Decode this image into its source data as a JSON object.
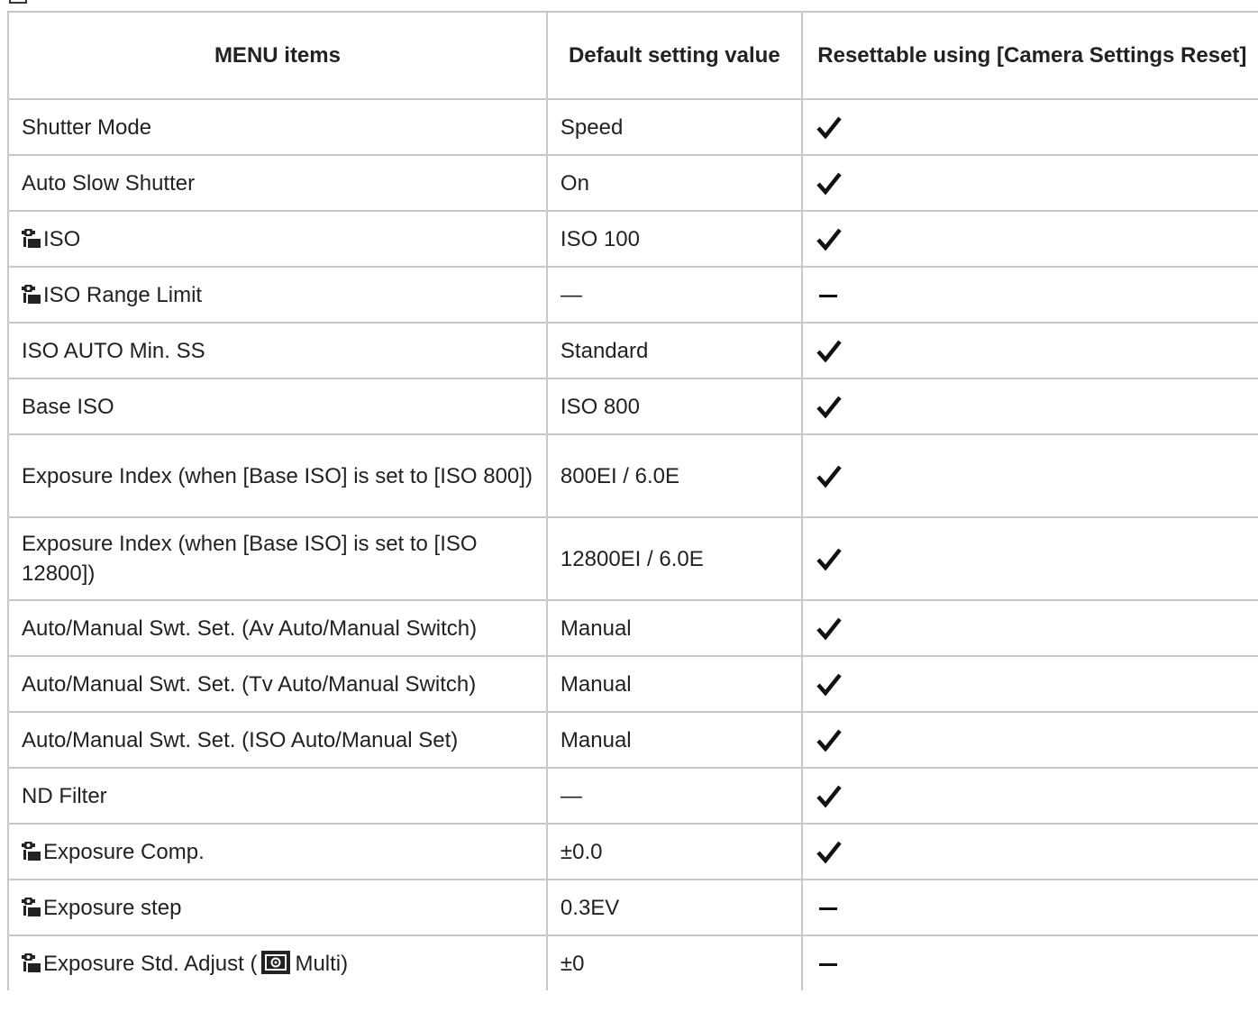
{
  "table": {
    "headers": [
      "MENU items",
      "Default setting value",
      "Resettable using [Camera Settings Reset]"
    ],
    "rows": [
      {
        "item": "Shutter Mode",
        "icon": "",
        "default": "Speed",
        "reset": "check"
      },
      {
        "item": "Auto Slow Shutter",
        "icon": "",
        "default": "On",
        "reset": "check"
      },
      {
        "item": "ISO",
        "icon": "camera-still-movie-icon",
        "default": "ISO 100",
        "reset": "check"
      },
      {
        "item": "ISO Range Limit",
        "icon": "camera-still-movie-icon",
        "default": "—",
        "reset": "dash"
      },
      {
        "item": "ISO AUTO Min. SS",
        "icon": "",
        "default": "Standard",
        "reset": "check"
      },
      {
        "item": "Base ISO",
        "icon": "",
        "default": "ISO 800",
        "reset": "check"
      },
      {
        "item": "Exposure Index (when [Base ISO] is set to [ISO 800])",
        "icon": "",
        "default": "800EI / 6.0E",
        "reset": "check"
      },
      {
        "item": "Exposure Index (when [Base ISO] is set to [ISO 12800])",
        "icon": "",
        "default": "12800EI / 6.0E",
        "reset": "check"
      },
      {
        "item": "Auto/Manual Swt. Set. (Av Auto/Manual Switch)",
        "icon": "",
        "default": "Manual",
        "reset": "check"
      },
      {
        "item": "Auto/Manual Swt. Set. (Tv Auto/Manual Switch)",
        "icon": "",
        "default": "Manual",
        "reset": "check"
      },
      {
        "item": "Auto/Manual Swt. Set. (ISO Auto/Manual Set)",
        "icon": "",
        "default": "Manual",
        "reset": "check"
      },
      {
        "item": "ND Filter",
        "icon": "",
        "default": "—",
        "reset": "check"
      },
      {
        "item": "Exposure Comp.",
        "icon": "camera-still-movie-icon",
        "default": "±0.0",
        "reset": "check"
      },
      {
        "item": "Exposure step",
        "icon": "camera-still-movie-icon",
        "default": "0.3EV",
        "reset": "dash"
      },
      {
        "item_prefix": "Exposure Std. Adjust (",
        "item_suffix": "Multi)",
        "icon": "camera-still-movie-icon",
        "inline_icon": "multi-metering-icon",
        "default": "±0",
        "reset": "dash"
      }
    ]
  }
}
